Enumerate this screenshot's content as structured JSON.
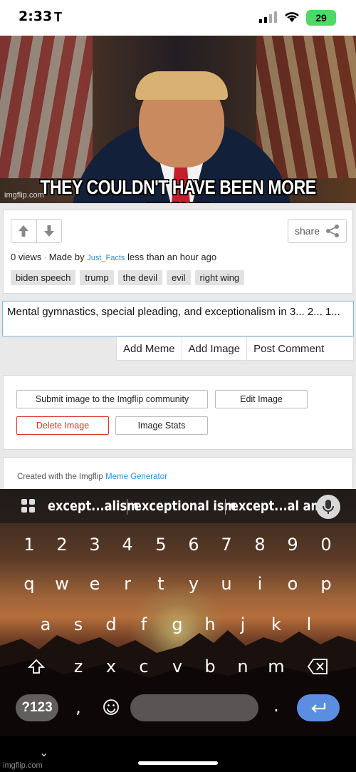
{
  "status": {
    "time": "2:33",
    "carrier_mark": "T",
    "battery": "29"
  },
  "meme": {
    "caption": "THEY COULDN'T HAVE BEEN MORE \"RIGHT\"",
    "watermark": "imgflip.com"
  },
  "post": {
    "share_label": "share",
    "views": "0 views",
    "made_by_prefix": "Made by",
    "author": "Just_Facts",
    "time_ago": "less than an hour ago",
    "tags": [
      "biden speech",
      "trump",
      "the devil",
      "evil",
      "right wing"
    ]
  },
  "comment": {
    "text": "Mental gymnastics, special pleading, and exceptionalism in 3... 2... 1...",
    "actions": [
      "Add Meme",
      "Add Image",
      "Post Comment"
    ]
  },
  "owner_tools": {
    "submit": "Submit image to the Imgflip community",
    "edit": "Edit Image",
    "delete": "Delete Image",
    "stats": "Image Stats"
  },
  "footer": {
    "created_prefix": "Created with the Imgflip",
    "generator_link": "Meme Generator"
  },
  "keyboard": {
    "suggestions": [
      "except...alism",
      "exceptional ism",
      "except...al am"
    ],
    "row_numbers": [
      "1",
      "2",
      "3",
      "4",
      "5",
      "6",
      "7",
      "8",
      "9",
      "0"
    ],
    "row_top": [
      "q",
      "w",
      "e",
      "r",
      "t",
      "y",
      "u",
      "i",
      "o",
      "p"
    ],
    "row_mid": [
      "a",
      "s",
      "d",
      "f",
      "g",
      "h",
      "j",
      "k",
      "l"
    ],
    "row_bottom": [
      "z",
      "x",
      "c",
      "v",
      "b",
      "n",
      "m"
    ],
    "symbols_key": "?123",
    "comma": ",",
    "period": "."
  },
  "navbar": {
    "watermark": "imgflip.com"
  }
}
